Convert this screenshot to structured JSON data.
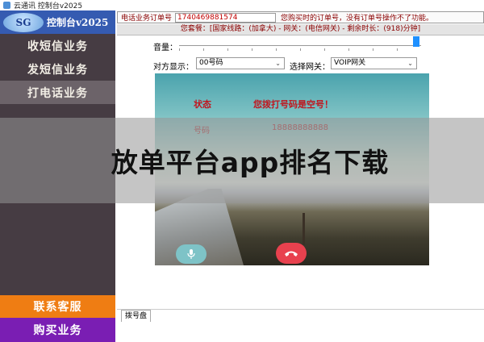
{
  "window": {
    "title": "云通讯 控制台v2025"
  },
  "sidebar": {
    "logo_text": "SG",
    "brand": "控制台v2025",
    "items": [
      {
        "label": "收短信业务"
      },
      {
        "label": "发短信业务"
      },
      {
        "label": "打电话业务"
      }
    ],
    "contact_label": "联系客服",
    "buy_label": "购买业务"
  },
  "order": {
    "label": "电话业务订单号",
    "value": "1740469881574",
    "note": "您购买时的订单号，没有订单号操作不了功能。"
  },
  "package": {
    "text": "您套餐：[国家线路：(加拿大) - 网关：(电信网关) - 剩余时长：(918)分钟]"
  },
  "volume": {
    "label": "音量：",
    "level": 0.98
  },
  "display_select": {
    "label": "对方显示：",
    "value": "00号码"
  },
  "gateway_select": {
    "label": "选择网关：",
    "value": "VOIP网关"
  },
  "call": {
    "status_label": "状态",
    "status_value": "您拨打号码是空号！",
    "number_label": "号码",
    "number_value": "18888888888"
  },
  "overlay": {
    "text": "放单平台app排名下载"
  },
  "bottom_tab": {
    "label": "拨号盘"
  },
  "colors": {
    "sidebar_bg": "#463c43",
    "contact_bg": "#ef7d13",
    "buy_bg": "#7a1eb3",
    "hangup": "#e8414e",
    "mic": "#7ec3c7"
  }
}
